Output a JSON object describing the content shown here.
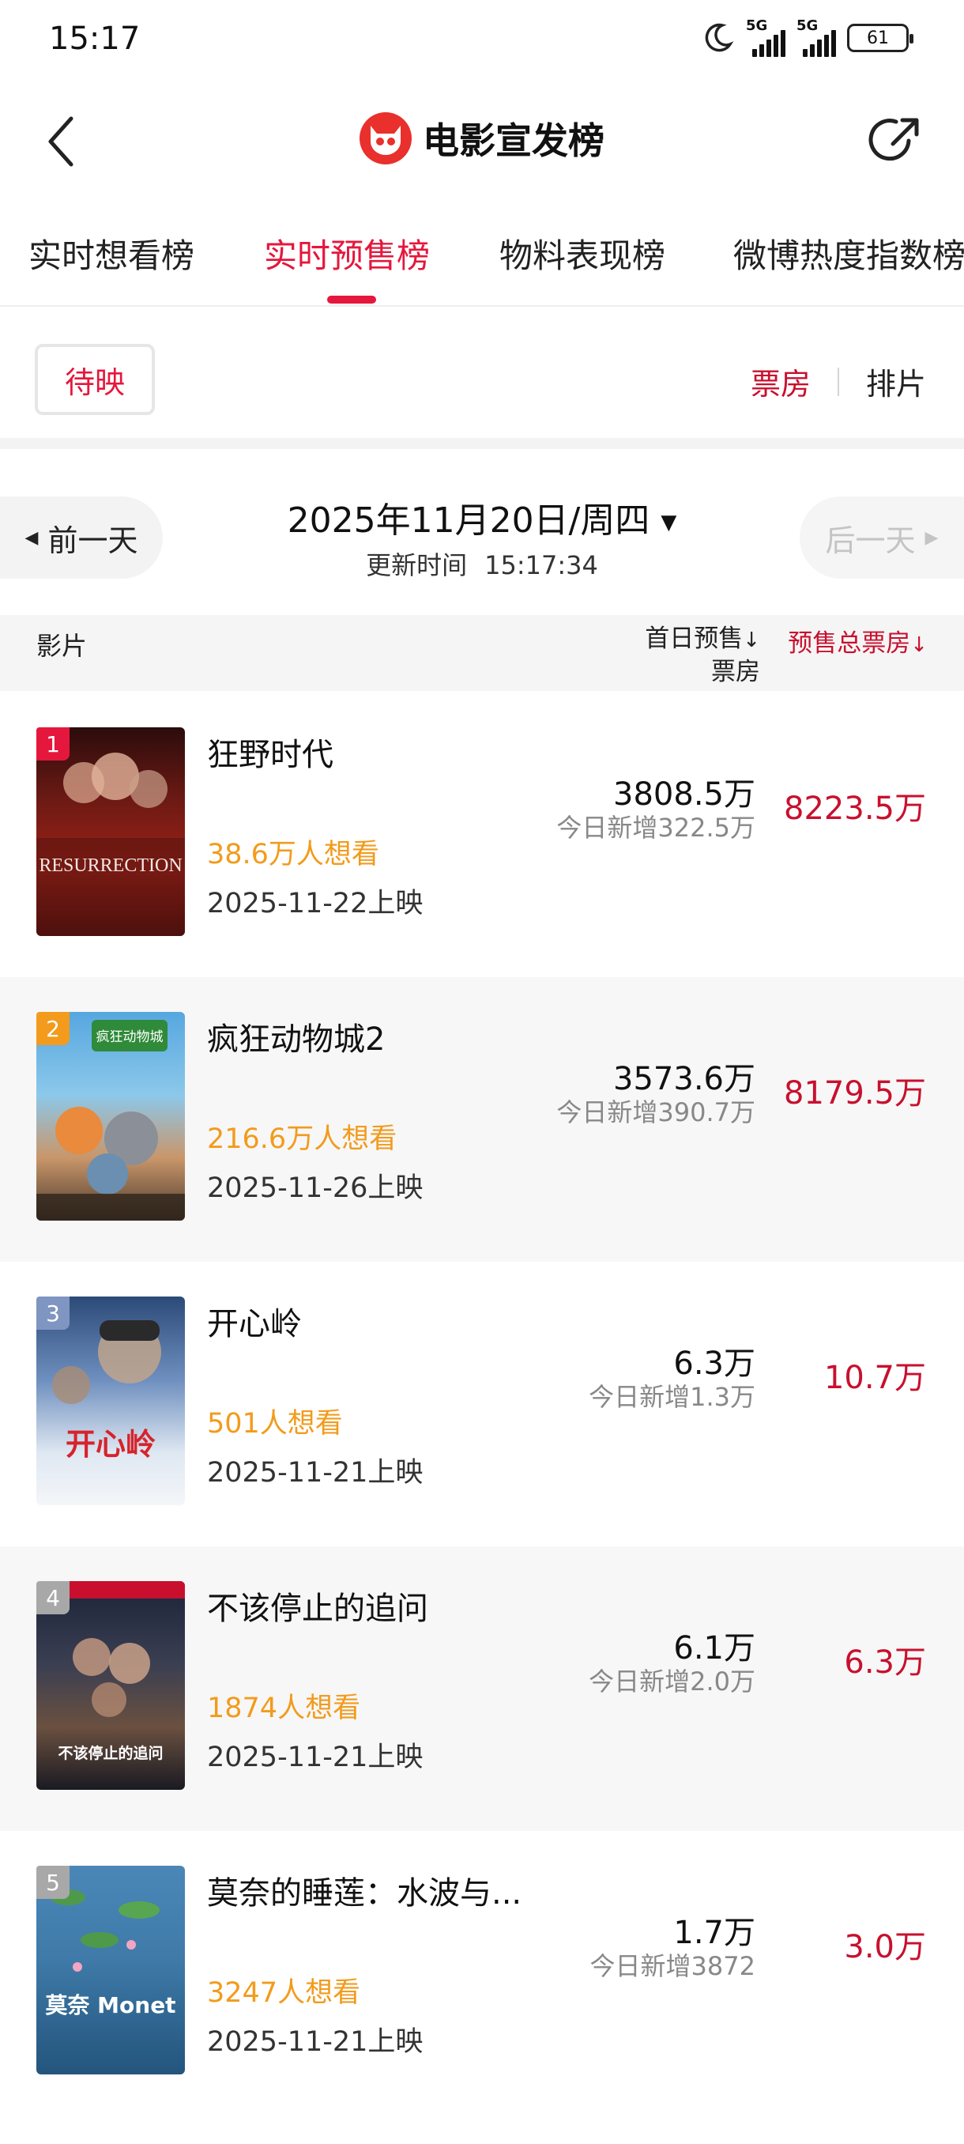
{
  "status_bar": {
    "time": "15:17",
    "network1": "5G",
    "network2": "5G",
    "battery": "61"
  },
  "header": {
    "title": "电影宣发榜"
  },
  "tabs": [
    {
      "label": "实时想看榜"
    },
    {
      "label": "实时预售榜"
    },
    {
      "label": "物料表现榜"
    },
    {
      "label": "微博热度指数榜"
    }
  ],
  "filter": {
    "status_label": "待映",
    "seg_on": "票房",
    "seg_off": "排片"
  },
  "date_nav": {
    "prev": "前一天",
    "next": "后一天",
    "date": "2025年11月20日/周四",
    "update_label": "更新时间",
    "update_time": "15:17:34"
  },
  "table_header": {
    "film": "影片",
    "first_day_line1": "首日预售",
    "first_day_line2": "票房",
    "total": "预售总票房"
  },
  "rows": [
    {
      "rank": "1",
      "title": "狂野时代",
      "want": "38.6万人想看",
      "release": "2025-11-22上映",
      "first_day": "3808.5万",
      "today_inc": "今日新增322.5万",
      "total": "8223.5万",
      "poster_text": "RESURRECTION",
      "rank_color": "#e5173c"
    },
    {
      "rank": "2",
      "title": "疯狂动物城2",
      "want": "216.6万人想看",
      "release": "2025-11-26上映",
      "first_day": "3573.6万",
      "today_inc": "今日新增390.7万",
      "total": "8179.5万",
      "poster_text": "疯狂动物城",
      "rank_color": "#f29b1c"
    },
    {
      "rank": "3",
      "title": "开心岭",
      "want": "501人想看",
      "release": "2025-11-21上映",
      "first_day": "6.3万",
      "today_inc": "今日新增1.3万",
      "total": "10.7万",
      "poster_text": "开心岭",
      "rank_color": "#7f95c2"
    },
    {
      "rank": "4",
      "title": "不该停止的追问",
      "want": "1874人想看",
      "release": "2025-11-21上映",
      "first_day": "6.1万",
      "today_inc": "今日新增2.0万",
      "total": "6.3万",
      "poster_text": "不该停止的追问",
      "rank_color": "#a8a8a8"
    },
    {
      "rank": "5",
      "title": "莫奈的睡莲：水波与...",
      "want": "3247人想看",
      "release": "2025-11-21上映",
      "first_day": "1.7万",
      "today_inc": "今日新增3872",
      "total": "3.0万",
      "poster_text": "莫奈 Monet",
      "rank_color": "#a8a8a8"
    }
  ]
}
